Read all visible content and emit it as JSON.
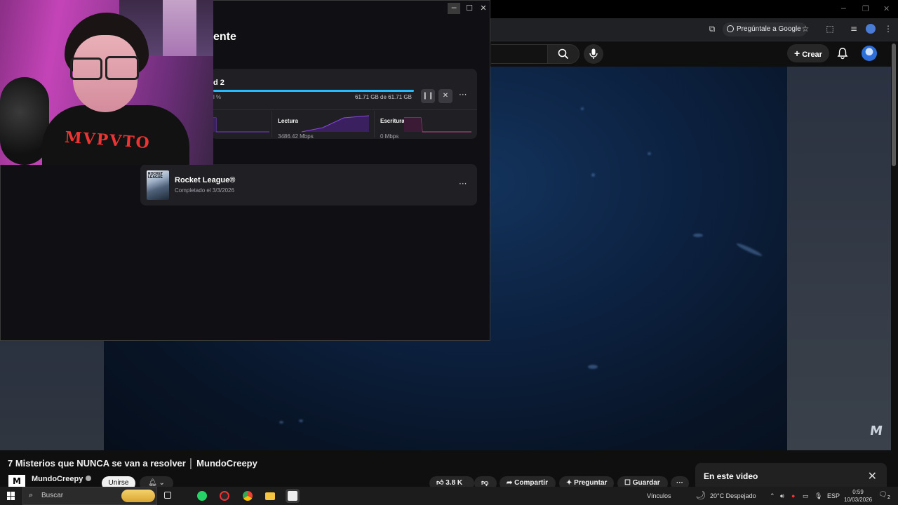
{
  "browser": {
    "ask_google_label": "Pregúntale a Google"
  },
  "youtube": {
    "create_label": "Crear",
    "video_title": "7 Misterios que NUNCA se van a resolver │ MundoCreepy",
    "channel_logo": "M",
    "channel_name": "MundoCreepy",
    "join_label": "Unirse",
    "likes": "3.8 K",
    "share_label": "Compartir",
    "ask_label": "Preguntar",
    "save_label": "Guardar",
    "in_video_title": "En este video",
    "watermark": "M"
  },
  "epic": {
    "heading_partial": "ente",
    "download": {
      "title_partial": "d 2",
      "percent_partial": "l %",
      "progress_fraction": 1.0,
      "size_text": "61.71 GB de 61.71 GB"
    },
    "stats": [
      {
        "label": "Lectura",
        "value": "3486.42 Mbps"
      },
      {
        "label": "Escritura",
        "value": "0 Mbps"
      }
    ],
    "completed": {
      "name": "Rocket League®",
      "status": "Completado el 3/3/2026",
      "cover_text": "ROCKET LEAGUE"
    },
    "accent_color": "#26bbff"
  },
  "webcam": {
    "shirt_text": "MVPVTO"
  },
  "taskbar": {
    "search_placeholder": "Buscar",
    "links_label": "Vínculos",
    "weather": "20°C  Despejado",
    "language": "ESP",
    "time": "0:59",
    "date": "10/03/2026",
    "notification_count": "2"
  }
}
